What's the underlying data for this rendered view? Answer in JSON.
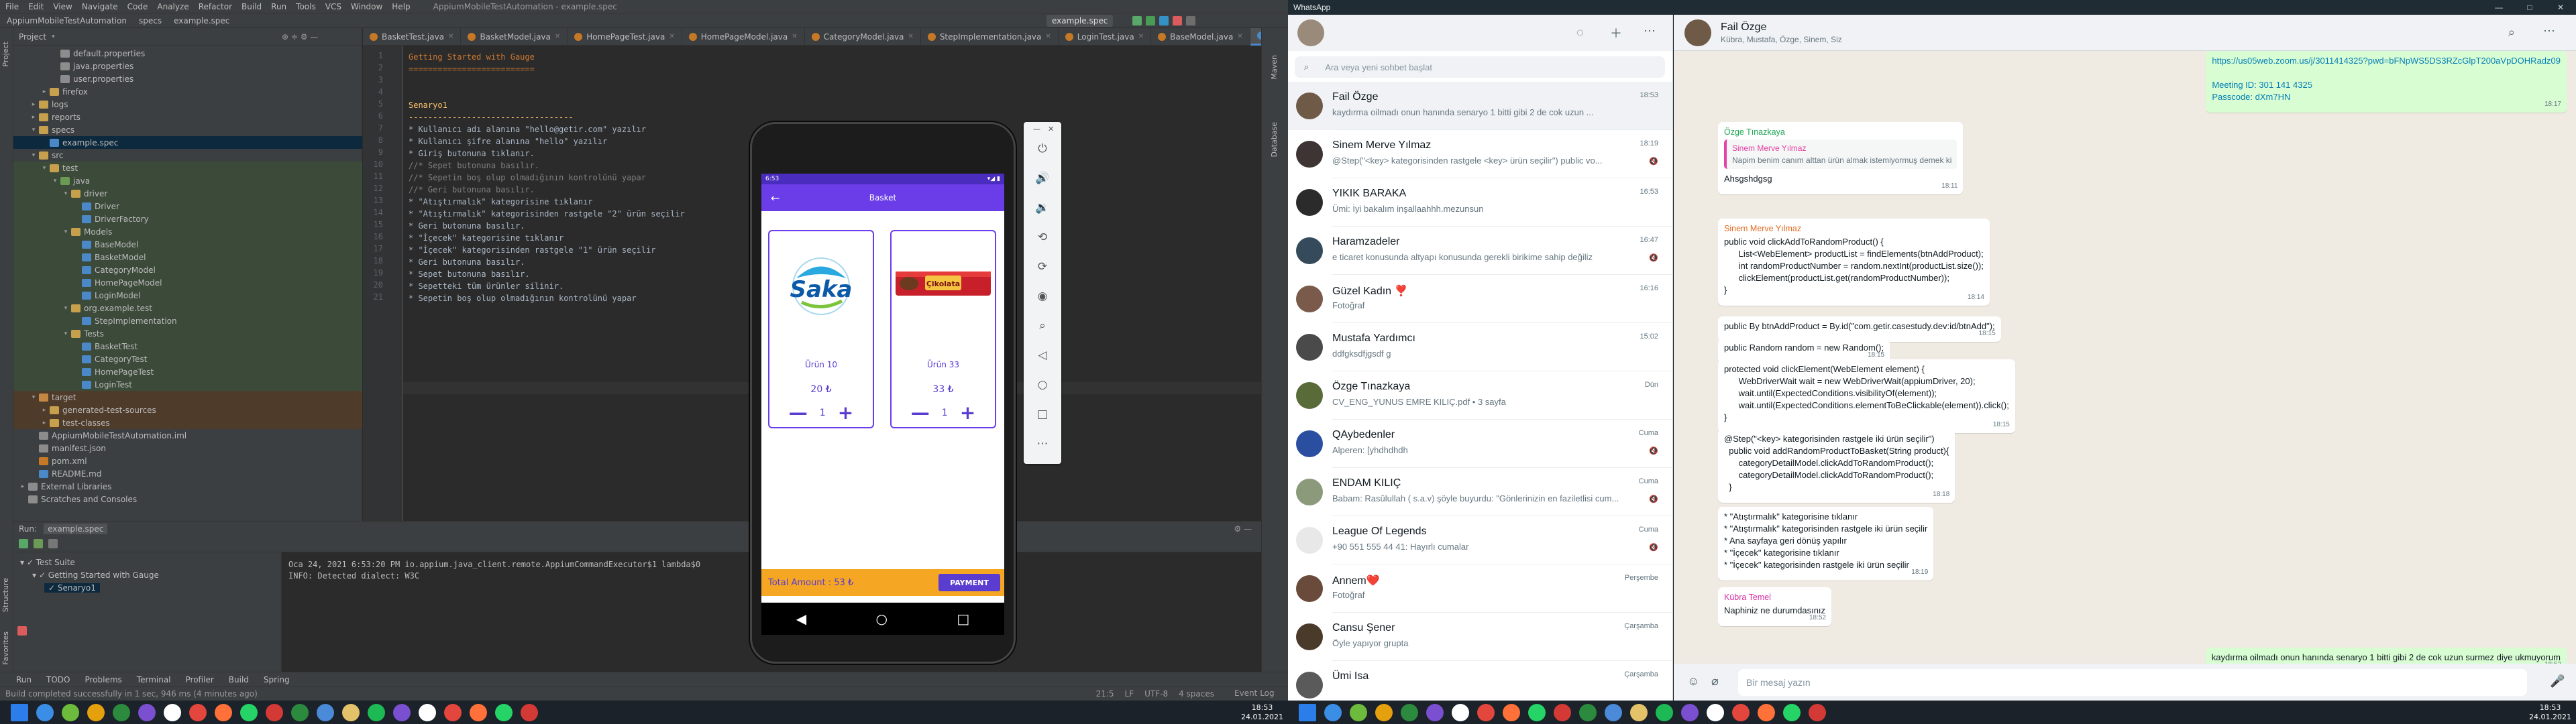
{
  "ide": {
    "menu": [
      "File",
      "Edit",
      "View",
      "Navigate",
      "Code",
      "Analyze",
      "Refactor",
      "Build",
      "Run",
      "Tools",
      "VCS",
      "Window",
      "Help"
    ],
    "window_title": "AppiumMobileTestAutomation - example.spec",
    "breadcrumbs": [
      "AppiumMobileTestAutomation",
      "specs",
      "example.spec"
    ],
    "run_config": "example.spec",
    "project_header": "Project",
    "tree": [
      {
        "label": "default.properties",
        "indent": 3,
        "icon": "#8c8c8c",
        "hl": ""
      },
      {
        "label": "java.properties",
        "indent": 3,
        "icon": "#8c8c8c",
        "hl": ""
      },
      {
        "label": "user.properties",
        "indent": 3,
        "icon": "#8c8c8c",
        "hl": ""
      },
      {
        "label": "firefox",
        "indent": 2,
        "icon": "#c6a04d",
        "hl": "",
        "arrow": "▸"
      },
      {
        "label": "logs",
        "indent": 1,
        "icon": "#c6a04d",
        "hl": "",
        "arrow": "▸"
      },
      {
        "label": "reports",
        "indent": 1,
        "icon": "#c6a04d",
        "hl": "",
        "arrow": "▸"
      },
      {
        "label": "specs",
        "indent": 1,
        "icon": "#c6a04d",
        "hl": "",
        "arrow": "▾"
      },
      {
        "label": "example.spec",
        "indent": 2,
        "icon": "#4a88c7",
        "hl": "sel"
      },
      {
        "label": "src",
        "indent": 1,
        "icon": "#c6a04d",
        "hl": "",
        "arrow": "▾"
      },
      {
        "label": "test",
        "indent": 2,
        "icon": "#c6a04d",
        "hl": "hl-test",
        "arrow": "▾"
      },
      {
        "label": "java",
        "indent": 3,
        "icon": "#6a9a53",
        "hl": "hl-test",
        "arrow": "▾"
      },
      {
        "label": "driver",
        "indent": 4,
        "icon": "#c6a04d",
        "hl": "hl-test",
        "arrow": "▾"
      },
      {
        "label": "Driver",
        "indent": 5,
        "icon": "#4a88c7",
        "hl": "hl-test"
      },
      {
        "label": "DriverFactory",
        "indent": 5,
        "icon": "#4a88c7",
        "hl": "hl-test"
      },
      {
        "label": "Models",
        "indent": 4,
        "icon": "#c6a04d",
        "hl": "hl-test",
        "arrow": "▾"
      },
      {
        "label": "BaseModel",
        "indent": 5,
        "icon": "#4a88c7",
        "hl": "hl-test"
      },
      {
        "label": "BasketModel",
        "indent": 5,
        "icon": "#4a88c7",
        "hl": "hl-test"
      },
      {
        "label": "CategoryModel",
        "indent": 5,
        "icon": "#4a88c7",
        "hl": "hl-test"
      },
      {
        "label": "HomePageModel",
        "indent": 5,
        "icon": "#4a88c7",
        "hl": "hl-test"
      },
      {
        "label": "LoginModel",
        "indent": 5,
        "icon": "#4a88c7",
        "hl": "hl-test"
      },
      {
        "label": "org.example.test",
        "indent": 4,
        "icon": "#c6a04d",
        "hl": "hl-test",
        "arrow": "▾"
      },
      {
        "label": "StepImplementation",
        "indent": 5,
        "icon": "#4a88c7",
        "hl": "hl-test"
      },
      {
        "label": "Tests",
        "indent": 4,
        "icon": "#c6a04d",
        "hl": "hl-test",
        "arrow": "▾"
      },
      {
        "label": "BasketTest",
        "indent": 5,
        "icon": "#4a88c7",
        "hl": "hl-test"
      },
      {
        "label": "CategoryTest",
        "indent": 5,
        "icon": "#4a88c7",
        "hl": "hl-test"
      },
      {
        "label": "HomePageTest",
        "indent": 5,
        "icon": "#4a88c7",
        "hl": "hl-test"
      },
      {
        "label": "LoginTest",
        "indent": 5,
        "icon": "#4a88c7",
        "hl": "hl-test"
      },
      {
        "label": "target",
        "indent": 1,
        "icon": "#c58842",
        "hl": "hl-target",
        "arrow": "▾"
      },
      {
        "label": "generated-test-sources",
        "indent": 2,
        "icon": "#c6a04d",
        "hl": "hl-target",
        "arrow": "▸"
      },
      {
        "label": "test-classes",
        "indent": 2,
        "icon": "#c6a04d",
        "hl": "hl-target",
        "arrow": "▸"
      },
      {
        "label": "AppiumMobileTestAutomation.iml",
        "indent": 1,
        "icon": "#8c8c8c",
        "hl": ""
      },
      {
        "label": "manifest.json",
        "indent": 1,
        "icon": "#8c8c8c",
        "hl": ""
      },
      {
        "label": "pom.xml",
        "indent": 1,
        "icon": "#c57825",
        "hl": ""
      },
      {
        "label": "README.md",
        "indent": 1,
        "icon": "#4a88c7",
        "hl": ""
      },
      {
        "label": "External Libraries",
        "indent": 0,
        "icon": "#8c8c8c",
        "hl": "",
        "arrow": "▸"
      },
      {
        "label": "Scratches and Consoles",
        "indent": 0,
        "icon": "#8c8c8c",
        "hl": ""
      }
    ],
    "tabs": [
      "BasketTest.java",
      "BasketModel.java",
      "HomePageTest.java",
      "HomePageModel.java",
      "CategoryModel.java",
      "StepImplementation.java",
      "LoginTest.java",
      "BaseModel.java",
      "example.spec"
    ],
    "code": [
      {
        "t": "Getting Started with Gauge",
        "c": "c-head"
      },
      {
        "t": "==========================",
        "c": "c-head"
      },
      {
        "t": "",
        "c": "c-txt"
      },
      {
        "t": "",
        "c": "c-txt"
      },
      {
        "t": "Senaryo1",
        "c": "c-kw"
      },
      {
        "t": "----------------------------------",
        "c": "c-kw"
      },
      {
        "t": "* Kullanıcı adı alanına \"hello@getir.com\" yazılır",
        "c": "c-txt"
      },
      {
        "t": "* Kullanıcı şifre alanına \"hello\" yazılır",
        "c": "c-txt"
      },
      {
        "t": "* Giriş butonuna tıklanır.",
        "c": "c-txt"
      },
      {
        "t": "//* Sepet butonuna basılır.",
        "c": "c-com"
      },
      {
        "t": "//* Sepetin boş olup olmadığının kontrolünü yapar",
        "c": "c-com"
      },
      {
        "t": "//* Geri butonuna basılır.",
        "c": "c-com"
      },
      {
        "t": "* \"Atıştırmalık\" kategorisine tıklanır",
        "c": "c-txt"
      },
      {
        "t": "* \"Atıştırmalık\" kategorisinden rastgele \"2\" ürün seçilir",
        "c": "c-txt"
      },
      {
        "t": "* Geri butonuna basılır.",
        "c": "c-txt"
      },
      {
        "t": "* \"İçecek\" kategorisine tıklanır",
        "c": "c-txt"
      },
      {
        "t": "* \"İçecek\" kategorisinden rastgele \"1\" ürün seçilir",
        "c": "c-txt"
      },
      {
        "t": "* Geri butonuna basılır.",
        "c": "c-txt"
      },
      {
        "t": "* Sepet butonuna basılır.",
        "c": "c-txt"
      },
      {
        "t": "* Sepetteki tüm ürünler silinir.",
        "c": "c-txt"
      },
      {
        "t": "* Sepetin boş olup olmadığının kontrolünü yapar",
        "c": "c-txt"
      }
    ],
    "run": {
      "label": "Run:",
      "config": "example.spec",
      "tree": [
        "Test Suite",
        "Getting Started with Gauge",
        "Senaryo1"
      ],
      "output": [
        "Oca 24, 2021 6:53:20 PM io.appium.java_client.remote.AppiumCommandExecutor$1 lambda$0",
        "INFO: Detected dialect: W3C"
      ]
    },
    "bottom_tabs": [
      "Run",
      "TODO",
      "Problems",
      "Terminal",
      "Profiler",
      "Build",
      "Spring"
    ],
    "status": "Build completed successfully in 1 sec, 946 ms (4 minutes ago)",
    "status_right": [
      "21:5",
      "LF",
      "UTF-8",
      "4 spaces"
    ],
    "event_log": "Event Log"
  },
  "emulator": {
    "status_left": "6:53",
    "status_right": "▾◢ ▮",
    "title": "Basket",
    "products": [
      {
        "name": "Ürün 10",
        "price": "20 ₺",
        "qty": "1",
        "image": "saka-water"
      },
      {
        "name": "Ürün 33",
        "price": "33 ₺",
        "qty": "1",
        "image": "chocolate-bar"
      }
    ],
    "total": "Total Amount : 53 ₺",
    "payment": "PAYMENT"
  },
  "whatsapp": {
    "app_title": "WhatsApp",
    "search_placeholder": "Ara veya yeni sohbet başlat",
    "chats": [
      {
        "name": "Fail Özge",
        "preview": "kaydırma oilmadı onun hanında senaryo 1 bitti gibi 2 de cok uzun ...",
        "time": "18:53",
        "avatar": "#6f5a48"
      },
      {
        "name": "Sinem Merve Yılmaz",
        "preview": "@Step(\"<key> kategorisinden rastgele <key> ürün seçilir\")  public vo...",
        "time": "18:19",
        "avatar": "#3e3434"
      },
      {
        "name": "YIKIK BARAKA",
        "preview": "Ümi: İyi bakalım inşallaahhh.mezunsun",
        "time": "16:53",
        "avatar": "#2b2b2b"
      },
      {
        "name": "Haramzadeler",
        "preview": "e ticaret konusunda altyapı konusunda gerekli birikime sahip değiliz",
        "time": "16:47",
        "avatar": "#354a5a"
      },
      {
        "name": "Güzel Kadın ❣️",
        "preview": "Fotoğraf",
        "time": "16:16",
        "avatar": "#7a5a4b"
      },
      {
        "name": "Mustafa Yardımcı",
        "preview": "ddfgksdfjgsdf g",
        "time": "15:02",
        "avatar": "#4a4a4a"
      },
      {
        "name": "Özge Tınazkaya",
        "preview": "CV_ENG_YUNUS EMRE KILIÇ.pdf • 3 sayfa",
        "time": "Dün",
        "avatar": "#5a6b3a"
      },
      {
        "name": "QAybedenler",
        "preview": "Alperen: [yhdhdhdh",
        "time": "Cuma",
        "avatar": "#2a4fa0"
      },
      {
        "name": "ENDAM KILIÇ",
        "preview": "Babam: Rasûlullah ( s.a.v) şöyle buyurdu: \"Gönlerinizin en faziletlisi cum...",
        "time": "Cuma",
        "avatar": "#8a9a7a"
      },
      {
        "name": "League Of Legends",
        "preview": "+90 551 555 44 41: Hayırlı cumalar",
        "time": "Cuma",
        "avatar": "#e8e8e8"
      },
      {
        "name": "Annem❤️",
        "preview": "Fotoğraf",
        "time": "Perşembe",
        "avatar": "#6a4a3a"
      },
      {
        "name": "Cansu Şener",
        "preview": "Öyle yapıyor grupta",
        "time": "Çarşamba",
        "avatar": "#4a3a2a"
      },
      {
        "name": "Ümi Isa",
        "preview": "",
        "time": "Çarşamba",
        "avatar": "#5a5a5a"
      }
    ],
    "conversation": {
      "name": "Fail Özge",
      "members": "Kübra, Mustafa, Özge, Sinem, Siz",
      "composer_placeholder": "Bir mesaj yazın",
      "messages": [
        {
          "out": true,
          "text": "https://us05web.zoom.us/j/3011414325?pwd=bFNpWS5DS3RZcGlpT200aVpDOHRadz09\n\nMeeting ID: 301 141 4325\nPasscode: dXm7HN",
          "time": "18:17",
          "link": true
        },
        {
          "out": false,
          "sender": "Özge Tınazkaya",
          "sender_color": "#1fa855",
          "quote_sender": "Sinem Merve Yılmaz",
          "quote_text": "Napim benim canım alttan ürün almak istemiyormuş demek ki",
          "text": "Ahsgshdgsg",
          "time": "18:11"
        },
        {
          "out": false,
          "sender": "Sinem Merve Yılmaz",
          "sender_color": "#e26a1f",
          "text": "public void clickAddToRandomProduct() {\n      List<WebElement> productList = findElements(btnAddProduct);\n      int randomProductNumber = random.nextInt(productList.size());\n      clickElement(productList.get(randomProductNumber));\n}",
          "time": "18:14"
        },
        {
          "out": false,
          "text": "public By btnAddProduct = By.id(\"com.getir.casestudy.dev:id/btnAdd\");",
          "time": "18:15"
        },
        {
          "out": false,
          "text": "public Random random = new Random();",
          "time": "18:15"
        },
        {
          "out": false,
          "text": "protected void clickElement(WebElement element) {\n      WebDriverWait wait = new WebDriverWait(appiumDriver, 20);\n      wait.until(ExpectedConditions.visibilityOf(element));\n      wait.until(ExpectedConditions.elementToBeClickable(element)).click();\n}",
          "time": "18:15"
        },
        {
          "out": false,
          "text": "@Step(\"<key> kategorisinden rastgele iki ürün seçilir\")\n  public void addRandomProductToBasket(String product){\n      categoryDetailModel.clickAddToRandomProduct();\n      categoryDetailModel.clickAddToRandomProduct();\n  }",
          "time": "18:18"
        },
        {
          "out": false,
          "text": "* \"Atıştırmalık\" kategorisine tıklanır\n* \"Atıştırmalık\" kategorisinden rastgele iki ürün seçilir\n* Ana sayfaya geri dönüş yapılır\n* \"İçecek\" kategorisine tıklanır\n* \"İçecek\" kategorisinden rastgele iki ürün seçilir",
          "time": "18:19"
        },
        {
          "out": false,
          "sender": "Kübra Temel",
          "sender_color": "#d62ea3",
          "text": "Naphiniz ne durumdasınız",
          "time": "18:52"
        },
        {
          "out": true,
          "text": "kaydırma oilmadı onun hanında senaryo 1 bitti gibi 2 de cok uzun surmez diye ukmuyorum",
          "time": "18:53"
        }
      ]
    }
  },
  "taskbar": {
    "left_time": "18:53",
    "left_date": "24.01.2021",
    "right_time": "18:53",
    "right_date": "24.01.2021",
    "icons": [
      "#3a8ee6",
      "#6cbb3c",
      "#e5a00d",
      "#2b8a3e",
      "#7a4fd0",
      "#ffffff",
      "#e2463d",
      "#ff7139",
      "#25d366",
      "#d33a35",
      "#2b8a3e",
      "#4a8ad8",
      "#e3c26a",
      "#1db954",
      "#7a4fd0",
      "#ffffff",
      "#e2463d",
      "#ff7139",
      "#25d366",
      "#d33a35"
    ]
  }
}
